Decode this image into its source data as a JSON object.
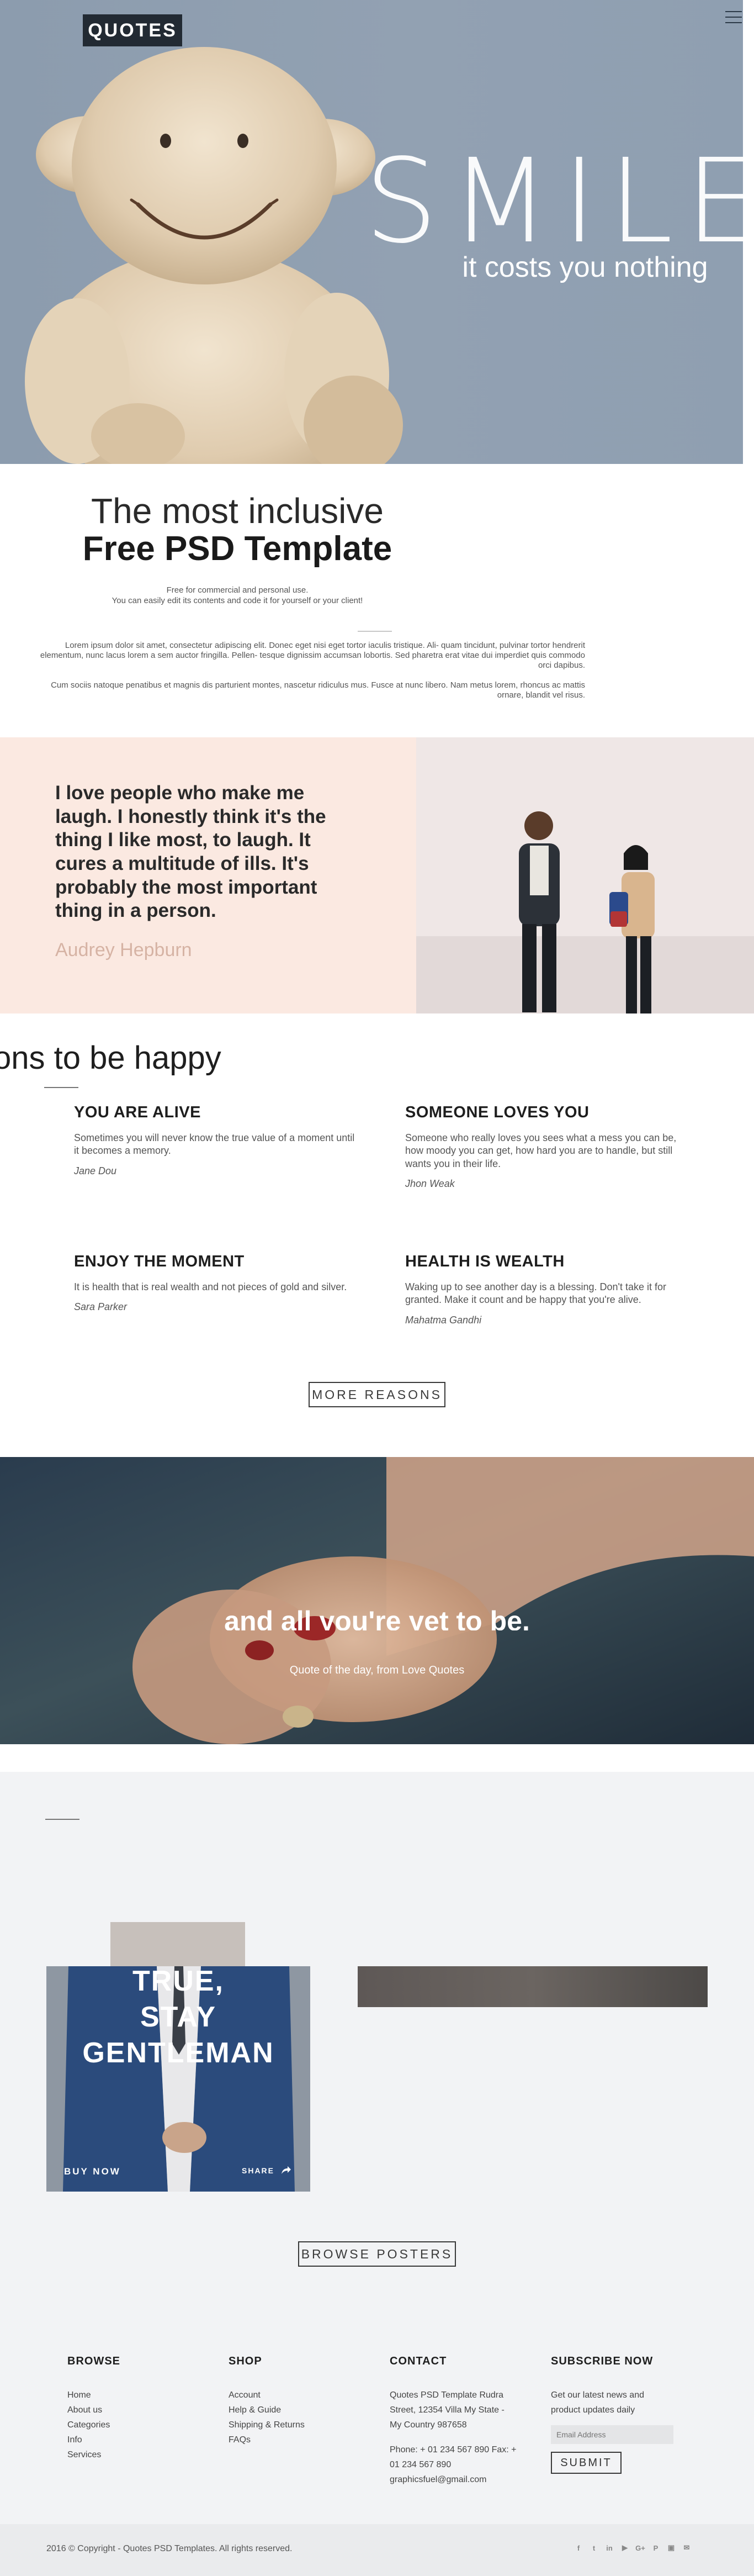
{
  "header": {
    "logo": "QUOTES",
    "hero_title": "SMILE",
    "hero_subtitle": "it costs you nothing"
  },
  "intro": {
    "title_line1": "The most inclusive",
    "title_line2": "Free PSD Template",
    "small_line1": "Free for commercial and personal use.",
    "small_line2": "You can easily edit its contents and code it for yourself or your client!",
    "paragraph1": "Lorem ipsum dolor sit amet, consectetur adipiscing elit. Donec eget nisi eget tortor iaculis tristique. Ali- quam tincidunt, pulvinar tortor hendrerit elementum, nunc lacus lorem a sem auctor fringilla. Pellen- tesque dignissim accumsan lobortis. Sed pharetra erat vitae dui imperdiet quis commodo orci dapibus.",
    "paragraph2": "Cum sociis natoque penatibus et magnis dis parturient montes, nascetur ridiculus mus. Fusce at nunc libero. Nam metus lorem, rhoncus ac mattis ornare, blandit vel risus."
  },
  "quote": {
    "text": "I love people who make me laugh. I honestly think it's the thing I like most, to laugh. It cures a multitude of ills. It's probably the most important thing in a person.",
    "author": "Audrey Hepburn"
  },
  "reasons": {
    "title": "ons to be happy",
    "items": [
      {
        "title": "YOU ARE ALIVE",
        "text": "Sometimes you will never know the true value of a moment until it becomes a memory.",
        "author": "Jane Dou"
      },
      {
        "title": "SOMEONE LOVES YOU",
        "text": "Someone who really loves you sees what a mess you can be, how moody you can get, how hard you are to handle, but still wants you in their life.",
        "author": "Jhon Weak"
      },
      {
        "title": "ENJOY THE MOMENT",
        "text": "It is health that is real wealth and not pieces of gold and silver.",
        "author": "Sara Parker"
      },
      {
        "title": "HEALTH IS WEALTH",
        "text": "Waking up to see another day is a blessing. Don't take it for granted. Make it count and be happy that you're alive.",
        "author": "Mahatma Gandhi"
      }
    ],
    "button": "MORE REASONS"
  },
  "quote_of_day": {
    "text": "and all you're yet to be.",
    "caption": "Quote of the day, from Love Quotes"
  },
  "posters": {
    "poster_text_1": "TRUE,",
    "poster_text_2": "STAY",
    "poster_text_3": "GENTLEMAN",
    "buy_label": "BUY NOW",
    "share_label": "SHARE",
    "button": "BROWSE POSTERS"
  },
  "footer": {
    "browse": {
      "heading": "BROWSE",
      "links": [
        "Home",
        "About us",
        "Categories",
        "Info",
        "Services"
      ]
    },
    "shop": {
      "heading": "SHOP",
      "links": [
        "Account",
        "Help & Guide",
        "Shipping & Returns",
        "FAQs"
      ]
    },
    "contact": {
      "heading": "CONTACT",
      "address": [
        "Quotes PSD Template Rudra",
        "Street, 12354 Villa My State -",
        "My Country 987658"
      ],
      "phone": [
        "Phone: + 01 234 567 890 Fax: +",
        "01 234 567 890"
      ],
      "email": "graphicsfuel@gmail.com"
    },
    "subscribe": {
      "heading": "SUBSCRIBE NOW",
      "text": [
        "Get our latest news and",
        "product updates daily"
      ],
      "placeholder": "Email Address",
      "button": "SUBMIT"
    },
    "copyright": "2016 © Copyright - Quotes PSD Templates. All rights reserved.",
    "social": [
      "f",
      "t",
      "in",
      "yt",
      "G+",
      "P",
      "ig",
      "mail"
    ]
  },
  "colors": {
    "hero_bg": "#8f9fb1",
    "quote_bg": "#fbe9e1",
    "author_color": "#d6b3a4",
    "section_bg": "#f2f3f5"
  }
}
